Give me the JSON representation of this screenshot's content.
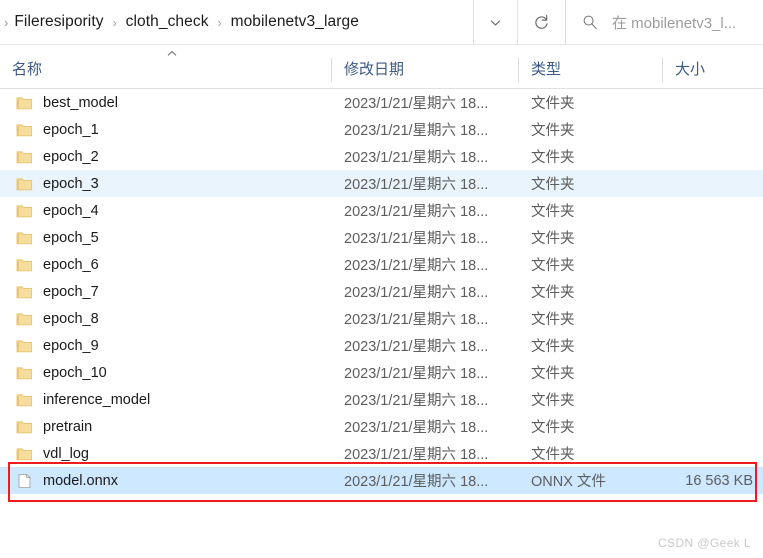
{
  "addressbar": {
    "lead_chevron_icon": "chevron-right-icon",
    "breadcrumbs": [
      {
        "label": "Fileresipority"
      },
      {
        "label": "cloth_check"
      },
      {
        "label": "mobilenetv3_large"
      }
    ],
    "separator": "›",
    "dropdown_icon": "chevron-down-icon",
    "refresh_icon": "refresh-icon",
    "search": {
      "icon": "search-icon",
      "placeholder": "在 mobilenetv3_l...",
      "value": ""
    }
  },
  "columns": {
    "name": "名称",
    "date_modified": "修改日期",
    "type": "类型",
    "size": "大小",
    "sort_icon": "chevron-up-icon",
    "sort_column": "name",
    "sort_direction": "ascending"
  },
  "files": [
    {
      "name": "best_model",
      "date": "2023/1/21/星期六 18...",
      "type": "文件夹",
      "size": "",
      "icon": "folder-icon",
      "state": "normal"
    },
    {
      "name": "epoch_1",
      "date": "2023/1/21/星期六 18...",
      "type": "文件夹",
      "size": "",
      "icon": "folder-icon",
      "state": "normal"
    },
    {
      "name": "epoch_2",
      "date": "2023/1/21/星期六 18...",
      "type": "文件夹",
      "size": "",
      "icon": "folder-icon",
      "state": "normal"
    },
    {
      "name": "epoch_3",
      "date": "2023/1/21/星期六 18...",
      "type": "文件夹",
      "size": "",
      "icon": "folder-icon",
      "state": "hover"
    },
    {
      "name": "epoch_4",
      "date": "2023/1/21/星期六 18...",
      "type": "文件夹",
      "size": "",
      "icon": "folder-icon",
      "state": "normal"
    },
    {
      "name": "epoch_5",
      "date": "2023/1/21/星期六 18...",
      "type": "文件夹",
      "size": "",
      "icon": "folder-icon",
      "state": "normal"
    },
    {
      "name": "epoch_6",
      "date": "2023/1/21/星期六 18...",
      "type": "文件夹",
      "size": "",
      "icon": "folder-icon",
      "state": "normal"
    },
    {
      "name": "epoch_7",
      "date": "2023/1/21/星期六 18...",
      "type": "文件夹",
      "size": "",
      "icon": "folder-icon",
      "state": "normal"
    },
    {
      "name": "epoch_8",
      "date": "2023/1/21/星期六 18...",
      "type": "文件夹",
      "size": "",
      "icon": "folder-icon",
      "state": "normal"
    },
    {
      "name": "epoch_9",
      "date": "2023/1/21/星期六 18...",
      "type": "文件夹",
      "size": "",
      "icon": "folder-icon",
      "state": "normal"
    },
    {
      "name": "epoch_10",
      "date": "2023/1/21/星期六 18...",
      "type": "文件夹",
      "size": "",
      "icon": "folder-icon",
      "state": "normal"
    },
    {
      "name": "inference_model",
      "date": "2023/1/21/星期六 18...",
      "type": "文件夹",
      "size": "",
      "icon": "folder-icon",
      "state": "normal"
    },
    {
      "name": "pretrain",
      "date": "2023/1/21/星期六 18...",
      "type": "文件夹",
      "size": "",
      "icon": "folder-icon",
      "state": "normal"
    },
    {
      "name": "vdl_log",
      "date": "2023/1/21/星期六 18...",
      "type": "文件夹",
      "size": "",
      "icon": "folder-icon",
      "state": "normal"
    },
    {
      "name": "model.onnx",
      "date": "2023/1/21/星期六 18...",
      "type": "ONNX 文件",
      "size": "16 563 KB",
      "icon": "file-icon",
      "state": "selected"
    }
  ],
  "annotation": {
    "highlight_color": "#ee1c1c",
    "target_row": "model.onnx"
  },
  "watermark": {
    "text": "CSDN @Geek L"
  },
  "colors": {
    "header_text": "#3c5a84",
    "selection": "#cde8ff",
    "hover": "#e9f4fd",
    "folder": "#f3d591"
  }
}
